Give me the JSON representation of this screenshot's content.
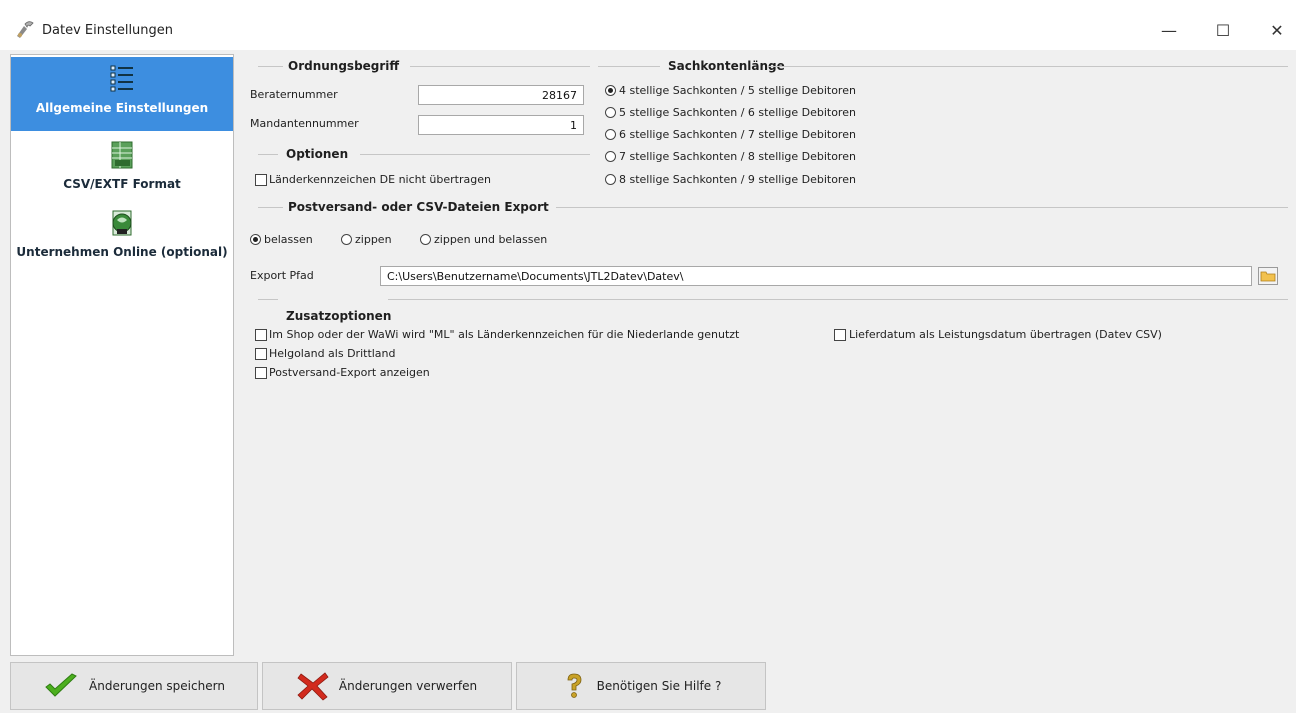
{
  "window": {
    "title": "Datev Einstellungen",
    "controls": {
      "minimize": "—",
      "maximize": "☐",
      "close": "✕"
    }
  },
  "sidebar": {
    "items": [
      {
        "label": "Allgemeine Einstellungen",
        "icon": "list-icon",
        "active": true
      },
      {
        "label": "CSV/EXTF Format",
        "icon": "csv-file-icon",
        "active": false
      },
      {
        "label": "Unternehmen Online (optional)",
        "icon": "online-document-icon",
        "active": false
      }
    ]
  },
  "ordnungsbegriff": {
    "title": "Ordnungsbegriff",
    "berater_label": "Beraternummer",
    "berater_value": "28167",
    "mandanten_label": "Mandantennummer",
    "mandanten_value": "1"
  },
  "sachkontenlaenge": {
    "title": "Sachkontenlänge",
    "options": [
      {
        "label": "4 stellige Sachkonten / 5 stellige Debitoren",
        "selected": true
      },
      {
        "label": "5 stellige Sachkonten / 6 stellige Debitoren",
        "selected": false
      },
      {
        "label": "6 stellige Sachkonten / 7 stellige Debitoren",
        "selected": false
      },
      {
        "label": "7 stellige Sachkonten / 8 stellige Debitoren",
        "selected": false
      },
      {
        "label": "8 stellige Sachkonten / 9 stellige Debitoren",
        "selected": false
      }
    ]
  },
  "optionen": {
    "title": "Optionen",
    "laenderkennzeichen_label": "Länderkennzeichen DE nicht übertragen",
    "laenderkennzeichen_checked": false
  },
  "export": {
    "title": "Postversand- oder CSV-Dateien Export",
    "modes": [
      {
        "label": "belassen",
        "selected": true
      },
      {
        "label": "zippen",
        "selected": false
      },
      {
        "label": "zippen und belassen",
        "selected": false
      }
    ],
    "path_label": "Export Pfad",
    "path_value": "C:\\Users\\Benutzername\\Documents\\JTL2Datev\\Datev\\"
  },
  "zusatzoptionen": {
    "title": "Zusatzoptionen",
    "options": [
      {
        "label": "Im Shop oder der WaWi wird \"ML\" als Länderkennzeichen für die Niederlande genutzt",
        "checked": false
      },
      {
        "label": "Lieferdatum als Leistungsdatum übertragen (Datev CSV)",
        "checked": false
      },
      {
        "label": "Helgoland als Drittland",
        "checked": false
      },
      {
        "label": "Postversand-Export anzeigen",
        "checked": false
      }
    ]
  },
  "footer": {
    "save_label": "Änderungen speichern",
    "discard_label": "Änderungen verwerfen",
    "help_label": "Benötigen Sie Hilfe ?"
  },
  "colors": {
    "accent": "#3d8ee0",
    "save_check": "#4caf1e",
    "discard_x": "#d22b1e",
    "help": "#c9a227"
  }
}
